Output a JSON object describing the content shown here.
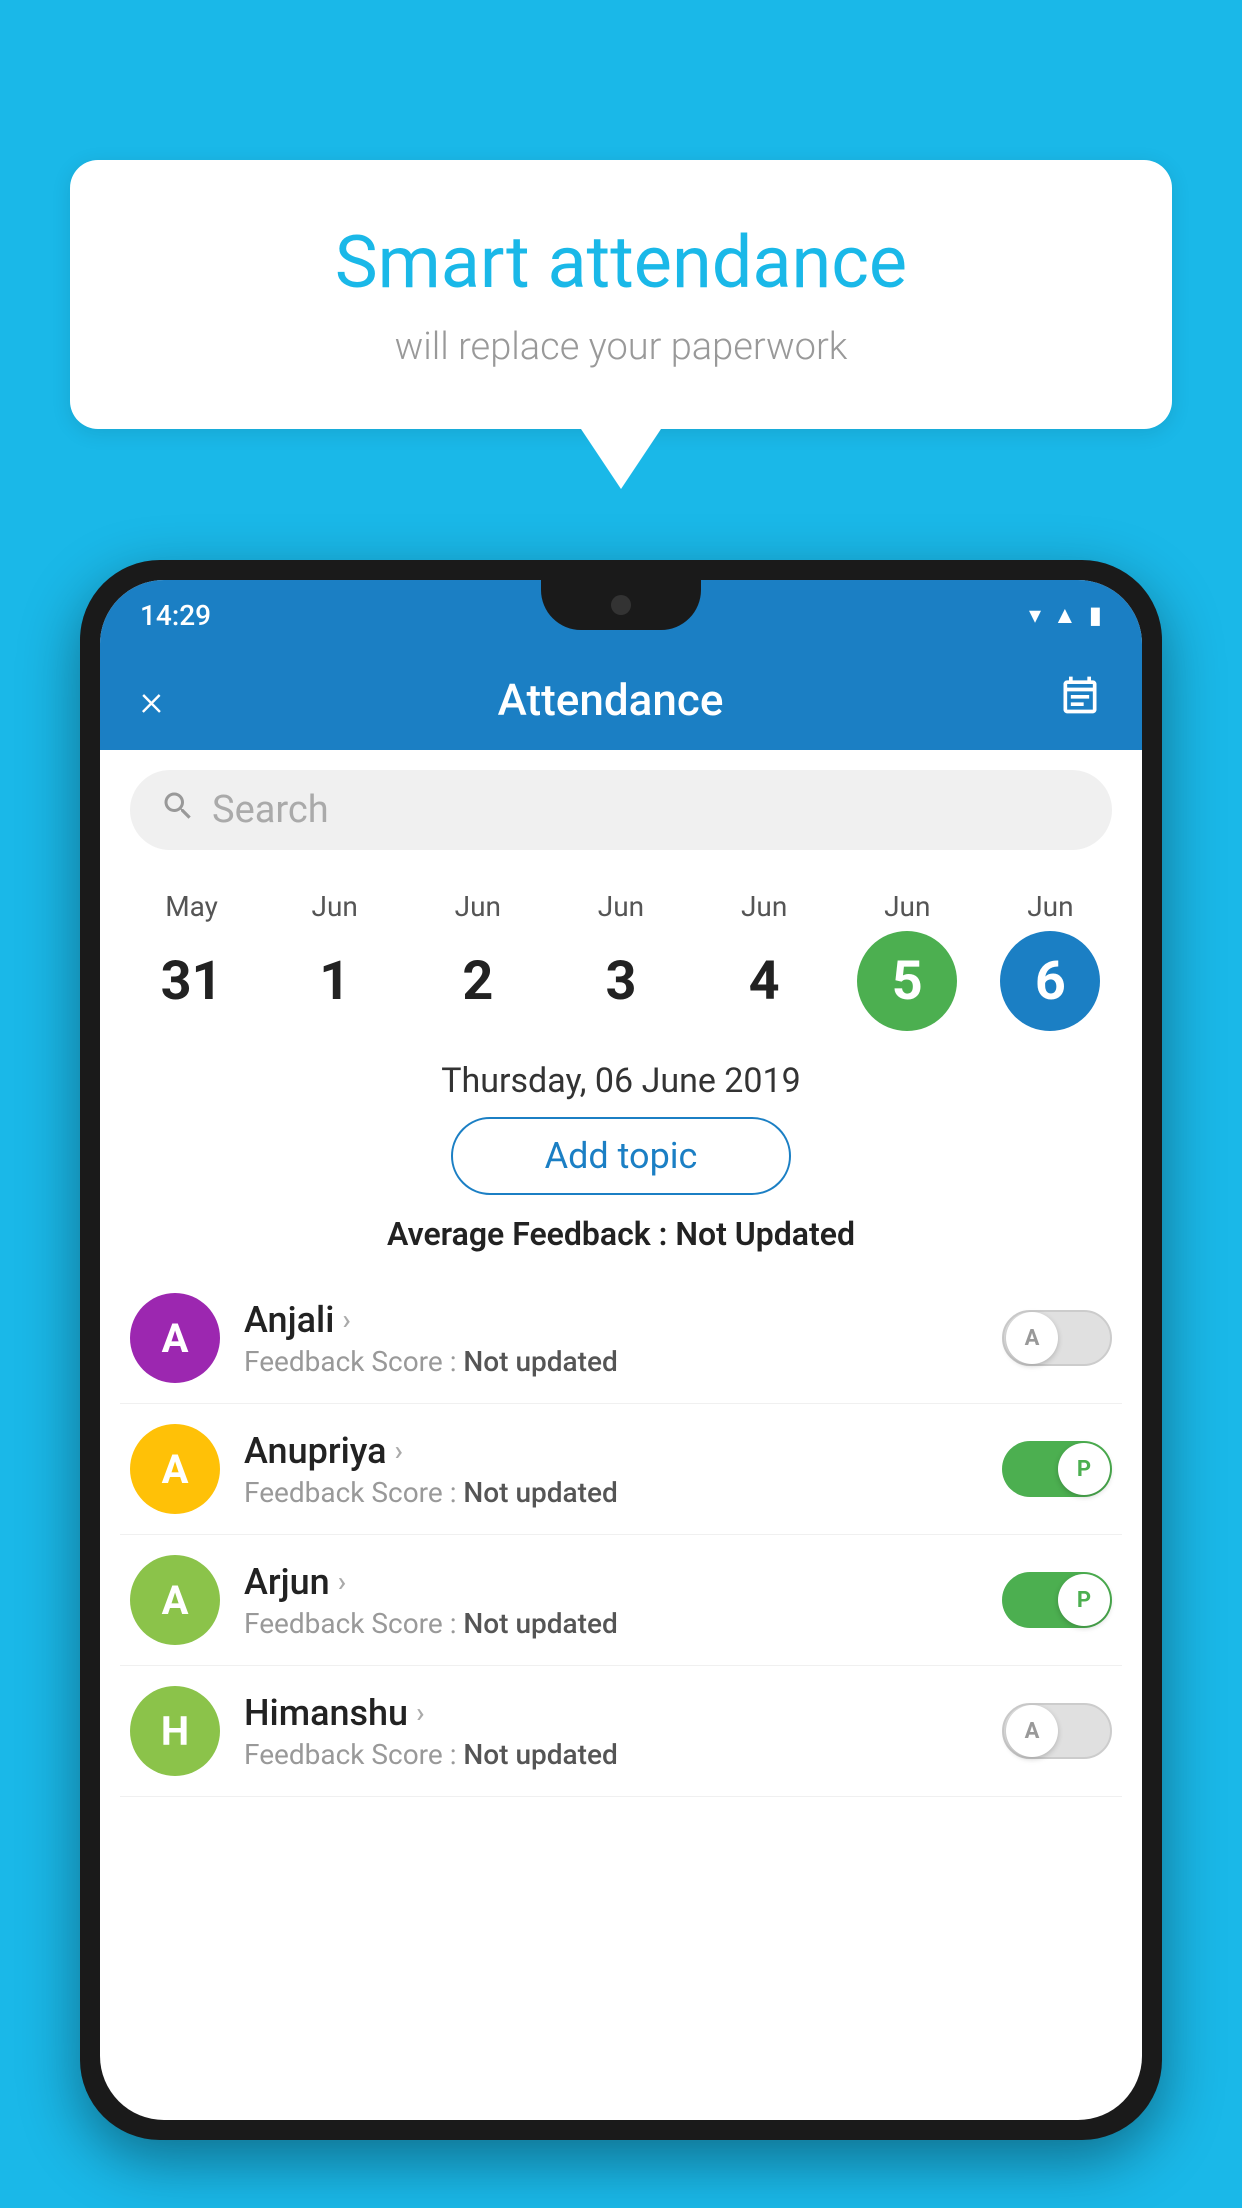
{
  "background_color": "#1ab8e8",
  "speech_bubble": {
    "title": "Smart attendance",
    "subtitle": "will replace your paperwork"
  },
  "status_bar": {
    "time": "14:29",
    "icons": [
      "wifi",
      "signal",
      "battery"
    ]
  },
  "app_header": {
    "title": "Attendance",
    "close_label": "×",
    "calendar_icon": "📅"
  },
  "search": {
    "placeholder": "Search"
  },
  "calendar": {
    "days": [
      {
        "month": "May",
        "date": "31",
        "state": "normal"
      },
      {
        "month": "Jun",
        "date": "1",
        "state": "normal"
      },
      {
        "month": "Jun",
        "date": "2",
        "state": "normal"
      },
      {
        "month": "Jun",
        "date": "3",
        "state": "normal"
      },
      {
        "month": "Jun",
        "date": "4",
        "state": "normal"
      },
      {
        "month": "Jun",
        "date": "5",
        "state": "today"
      },
      {
        "month": "Jun",
        "date": "6",
        "state": "selected"
      }
    ],
    "selected_label": "Thursday, 06 June 2019"
  },
  "add_topic_label": "Add topic",
  "average_feedback": {
    "label": "Average Feedback : ",
    "value": "Not Updated"
  },
  "students": [
    {
      "name": "Anjali",
      "avatar_letter": "A",
      "avatar_color": "#9c27b0",
      "feedback_label": "Feedback Score : ",
      "feedback_value": "Not updated",
      "toggle_state": "off",
      "toggle_letter": "A"
    },
    {
      "name": "Anupriya",
      "avatar_letter": "A",
      "avatar_color": "#ffc107",
      "feedback_label": "Feedback Score : ",
      "feedback_value": "Not updated",
      "toggle_state": "on",
      "toggle_letter": "P"
    },
    {
      "name": "Arjun",
      "avatar_letter": "A",
      "avatar_color": "#8bc34a",
      "feedback_label": "Feedback Score : ",
      "feedback_value": "Not updated",
      "toggle_state": "on",
      "toggle_letter": "P"
    },
    {
      "name": "Himanshu",
      "avatar_letter": "H",
      "avatar_color": "#8bc34a",
      "feedback_label": "Feedback Score : ",
      "feedback_value": "Not updated",
      "toggle_state": "off",
      "toggle_letter": "A"
    }
  ]
}
